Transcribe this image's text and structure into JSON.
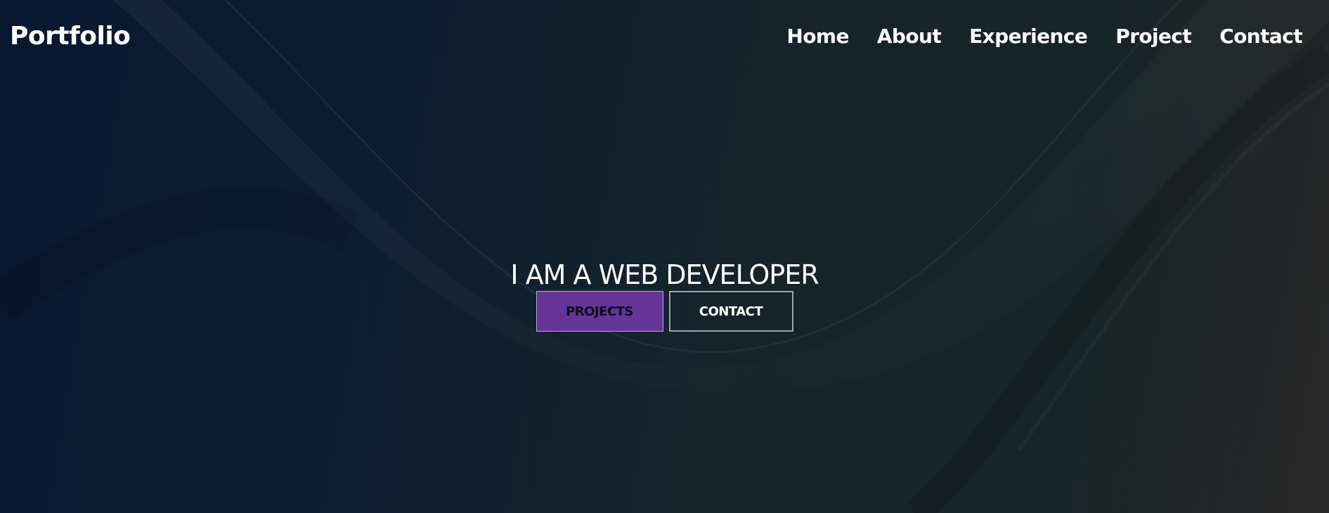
{
  "header": {
    "brand": "Portfolio",
    "nav": [
      "Home",
      "About",
      "Experience",
      "Project",
      "Contact"
    ]
  },
  "hero": {
    "title": "I AM A WEB DEVELOPER",
    "primary_button": "PROJECTS",
    "secondary_button": "CONTACT"
  },
  "colors": {
    "background_start": "#071731",
    "background_end": "#2c302f",
    "accent": "#663399",
    "text": "#ffffff"
  }
}
